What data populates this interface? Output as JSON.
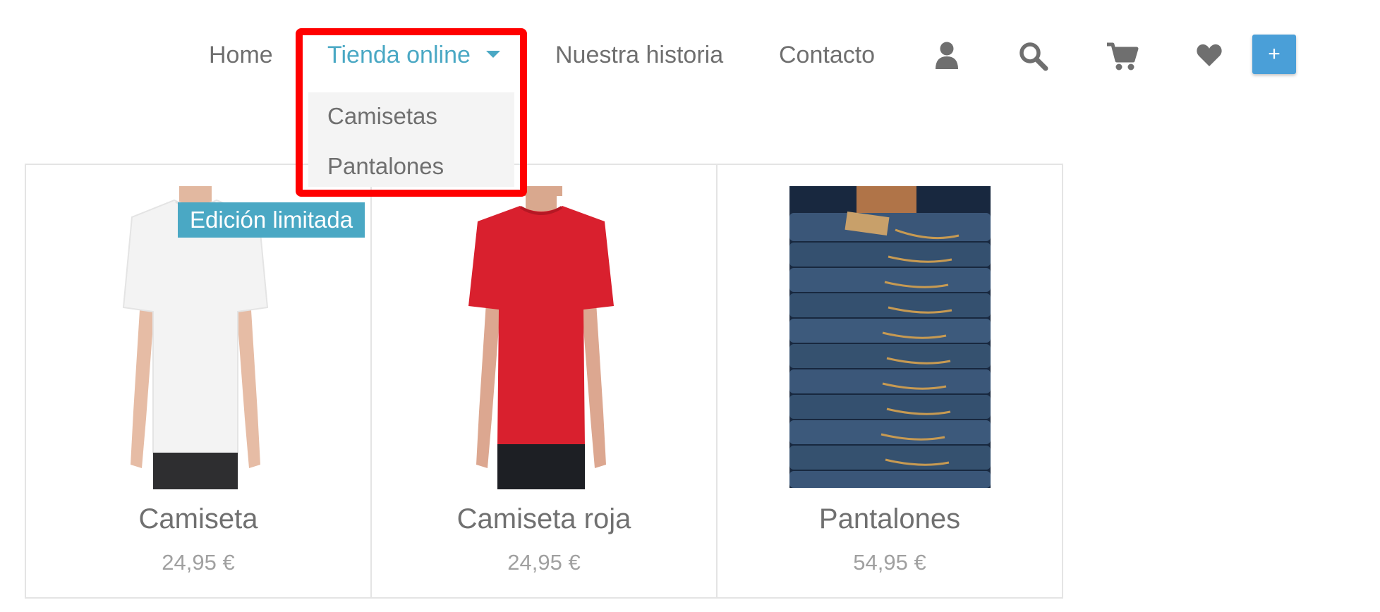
{
  "nav": {
    "items": [
      {
        "label": "Home"
      },
      {
        "label": "Tienda online"
      },
      {
        "label": "Nuestra historia"
      },
      {
        "label": "Contacto"
      }
    ],
    "plus_label": "+",
    "accent_color": "#4aa8c4",
    "button_color": "#4a9fd8",
    "icons": [
      "user-icon",
      "search-icon",
      "cart-icon",
      "heart-icon"
    ]
  },
  "dropdown": {
    "items": [
      {
        "label": "Camisetas"
      },
      {
        "label": "Pantalones"
      }
    ],
    "highlight_color": "#ff0000"
  },
  "products": [
    {
      "name": "Camiseta",
      "price": "24,95 €",
      "badge": "Edición limitada"
    },
    {
      "name": "Camiseta roja",
      "price": "24,95 €"
    },
    {
      "name": "Pantalones",
      "price": "54,95 €"
    }
  ]
}
